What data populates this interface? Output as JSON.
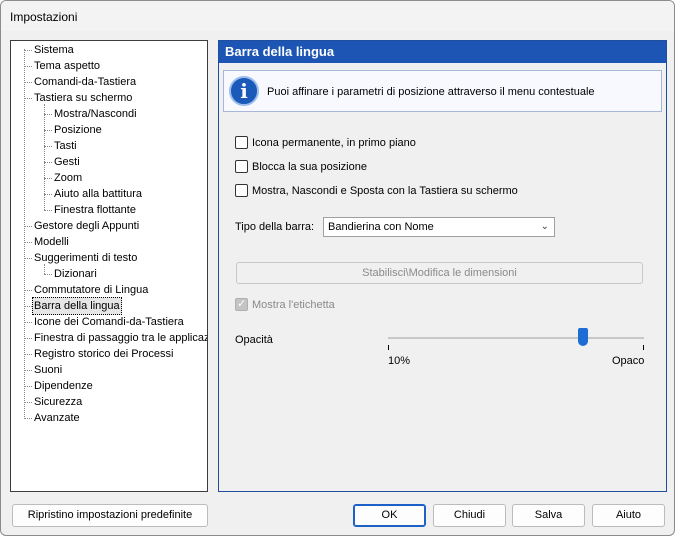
{
  "window": {
    "title": "Impostazioni"
  },
  "tree": {
    "items": [
      {
        "label": "Sistema",
        "level": 0
      },
      {
        "label": "Tema aspetto",
        "level": 0
      },
      {
        "label": "Comandi-da-Tastiera",
        "level": 0
      },
      {
        "label": "Tastiera su schermo",
        "level": 0
      },
      {
        "label": "Mostra/Nascondi",
        "level": 1
      },
      {
        "label": "Posizione",
        "level": 1
      },
      {
        "label": "Tasti",
        "level": 1
      },
      {
        "label": "Gesti",
        "level": 1
      },
      {
        "label": "Zoom",
        "level": 1
      },
      {
        "label": "Aiuto alla battitura",
        "level": 1
      },
      {
        "label": "Finestra flottante",
        "level": 1
      },
      {
        "label": "Gestore degli Appunti",
        "level": 0
      },
      {
        "label": "Modelli",
        "level": 0
      },
      {
        "label": "Suggerimenti di testo",
        "level": 0
      },
      {
        "label": "Dizionari",
        "level": 1
      },
      {
        "label": "Commutatore di Lingua",
        "level": 0
      },
      {
        "label": "Barra della lingua",
        "level": 0,
        "selected": true
      },
      {
        "label": "Icone dei Comandi-da-Tastiera",
        "level": 0
      },
      {
        "label": "Finestra di passaggio tra le applicazioni",
        "level": 0
      },
      {
        "label": "Registro storico dei Processi",
        "level": 0
      },
      {
        "label": "Suoni",
        "level": 0
      },
      {
        "label": "Dipendenze",
        "level": 0
      },
      {
        "label": "Sicurezza",
        "level": 0
      },
      {
        "label": "Avanzate",
        "level": 0
      }
    ]
  },
  "panel": {
    "header": "Barra della lingua",
    "info_icon": "info-icon",
    "info_text": "Puoi affinare i parametri di posizione attraverso il menu contestuale",
    "checkboxes": [
      {
        "label": "Icona permanente, in primo piano",
        "checked": false
      },
      {
        "label": "Blocca la sua posizione",
        "checked": false
      },
      {
        "label": "Mostra, Nascondi e Sposta con la Tastiera su schermo",
        "checked": false
      }
    ],
    "bar_type_label": "Tipo della barra:",
    "bar_type_value": "Bandierina con Nome",
    "size_button": "Stabilisci\\Modifica le dimensioni",
    "show_label_checkbox": {
      "label": "Mostra l'etichetta",
      "checked": true,
      "disabled": true
    },
    "opacity_label": "Opacità",
    "opacity_min": "10%",
    "opacity_max": "Opaco",
    "opacity_fraction": 0.76
  },
  "buttons": {
    "reset": "Ripristino impostazioni predefinite",
    "ok": "OK",
    "close": "Chiudi",
    "save": "Salva",
    "help": "Aiuto"
  },
  "colors": {
    "header_blue": "#1c55b3",
    "slider_thumb": "#1c6ed4"
  }
}
